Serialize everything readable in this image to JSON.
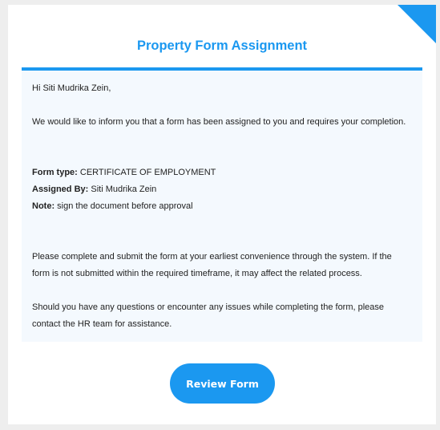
{
  "header": {
    "title": "Property Form Assignment"
  },
  "message": {
    "greeting": "Hi Siti Mudrika Zein,",
    "intro": "We would like to inform you that a form has been assigned to you and requires your completion.",
    "form_type_label": "Form type:",
    "form_type_value": "CERTIFICATE OF EMPLOYMENT",
    "assigned_by_label": "Assigned By:",
    "assigned_by_value": "Siti Mudrika Zein",
    "note_label": "Note:",
    "note_value": "sign the document before approval",
    "completion_text": "Please complete and submit the form at your earliest convenience through the system. If the form is not submitted within the required timeframe, it may affect the related process.",
    "questions_text": "Should you have any questions or encounter any issues while completing the form, please contact the HR team for assistance."
  },
  "actions": {
    "review_label": "Review Form"
  },
  "colors": {
    "accent": "#1b98f0",
    "body_background": "#f4f9fe",
    "page_background": "#eeeeee",
    "text": "#222222"
  }
}
